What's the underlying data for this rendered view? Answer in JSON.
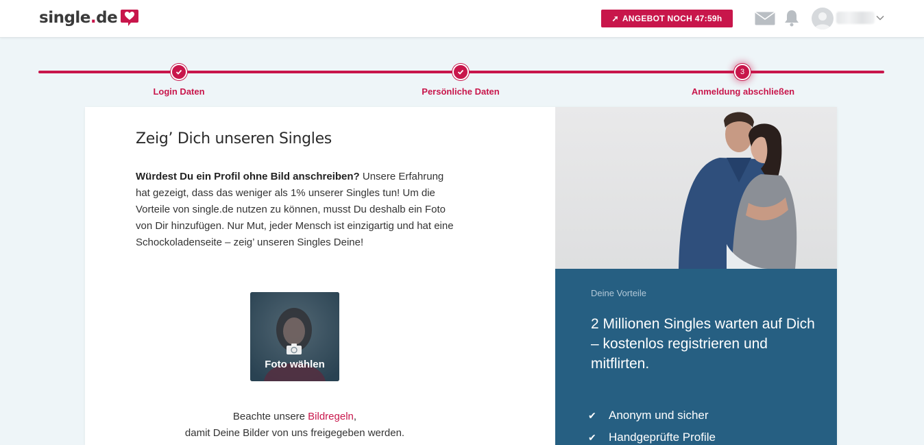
{
  "header": {
    "logo_text": "single",
    "logo_dot": ".",
    "logo_tld": "de",
    "offer_label": "ANGEBOT NOCH 47:59h",
    "icons": [
      "mail-icon",
      "bell-icon",
      "chevron-down-icon"
    ]
  },
  "progress": {
    "steps": [
      {
        "label": "Login Daten",
        "state": "done"
      },
      {
        "label": "Persönliche Daten",
        "state": "done"
      },
      {
        "label": "Anmeldung abschließen",
        "state": "active",
        "number": "3"
      }
    ]
  },
  "main": {
    "title": "Zeig’ Dich unseren Singles",
    "desc_bold": "Würdest Du ein Profil ohne Bild anschreiben?",
    "desc_rest": " Unsere Erfahrung hat gezeigt, dass das weniger als 1% unserer Singles tun! Um die Vorteile von single.de nutzen zu können, musst Du deshalb ein Foto von Dir hinzufügen. Nur Mut, jeder Mensch ist einzigartig und hat eine Schockoladenseite – zeig’ unseren Singles Deine!",
    "photo_button": "Foto wählen",
    "rules_prefix": "Beachte unsere ",
    "rules_link": "Bildregeln",
    "rules_suffix": ",",
    "rules_line2": "damit Deine Bilder von uns freigegeben werden."
  },
  "sidebar": {
    "kicker": "Deine Vorteile",
    "title": "2 Millionen Singles warten auf Dich – kostenlos registrieren und mitflirten.",
    "benefits": [
      "Anonym und sicher",
      "Handgeprüfte Profile"
    ]
  },
  "colors": {
    "brand": "#c8164b",
    "panel": "#265f82",
    "background": "#eef5f8"
  }
}
